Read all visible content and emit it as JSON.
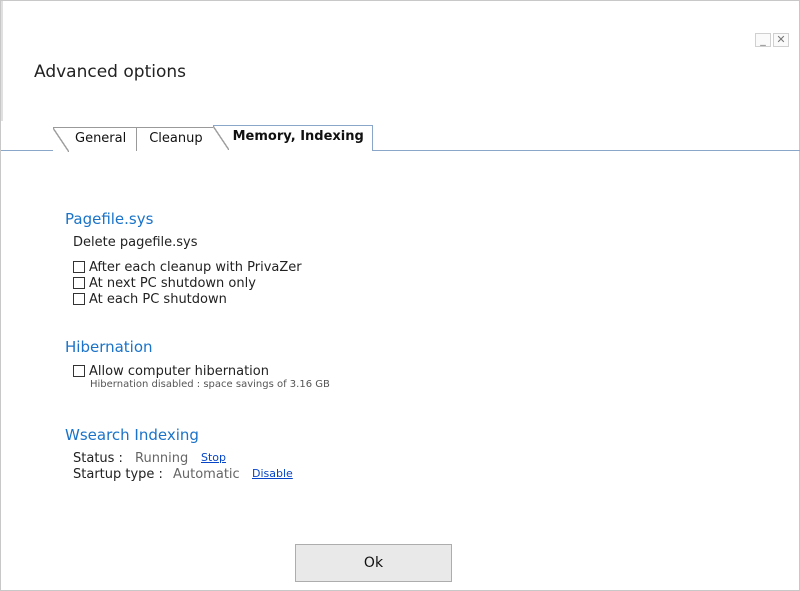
{
  "window": {
    "title": "Advanced options",
    "minimize_glyph": "_",
    "close_glyph": "✕"
  },
  "tabs": [
    {
      "label": "General",
      "active": false
    },
    {
      "label": "Cleanup",
      "active": false
    },
    {
      "label": "Memory, Indexing",
      "active": true
    }
  ],
  "pagefile": {
    "title": "Pagefile.sys",
    "subtitle": "Delete pagefile.sys",
    "options": [
      {
        "label": "After each cleanup with PrivaZer",
        "checked": false
      },
      {
        "label": "At next PC shutdown only",
        "checked": false
      },
      {
        "label": "At each PC shutdown",
        "checked": false
      }
    ]
  },
  "hibernation": {
    "title": "Hibernation",
    "option_label": "Allow computer hibernation",
    "checked": false,
    "note": "Hibernation disabled : space savings of 3.16 GB"
  },
  "wsearch": {
    "title": "Wsearch Indexing",
    "status_label": "Status :",
    "status_value": "Running",
    "status_action": "Stop",
    "startup_label": "Startup type :",
    "startup_value": "Automatic",
    "startup_action": "Disable"
  },
  "footer": {
    "ok_label": "Ok"
  },
  "colors": {
    "section_title": "#1a73c8",
    "link": "#0645c8",
    "tab_line": "#8aa6c8"
  }
}
